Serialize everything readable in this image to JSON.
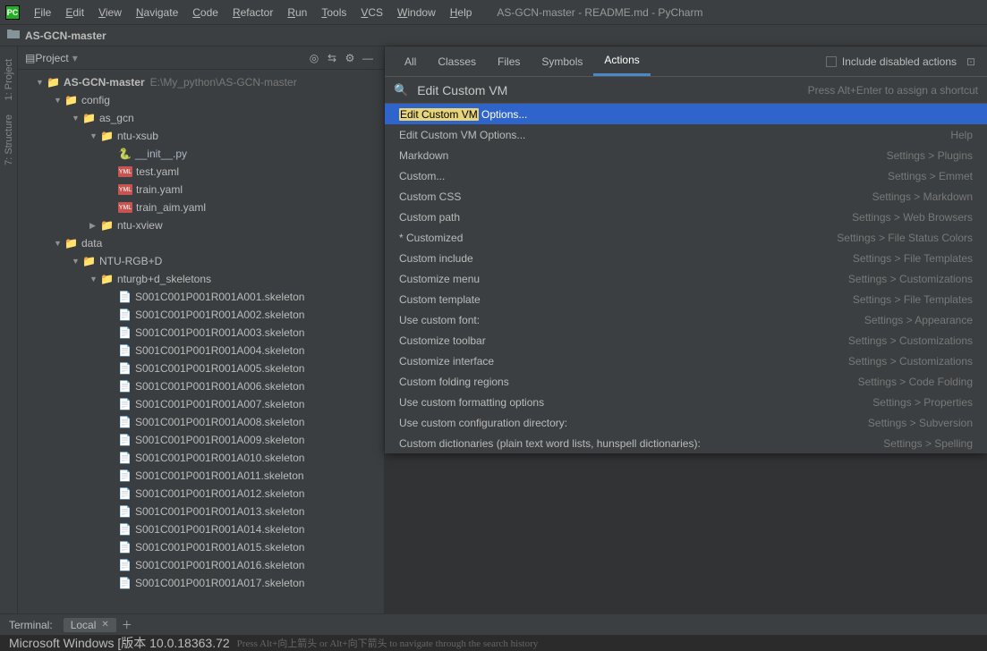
{
  "window": {
    "title": "AS-GCN-master - README.md - PyCharm"
  },
  "menu": {
    "items": [
      "File",
      "Edit",
      "View",
      "Navigate",
      "Code",
      "Refactor",
      "Run",
      "Tools",
      "VCS",
      "Window",
      "Help"
    ]
  },
  "breadcrumb": {
    "root": "AS-GCN-master"
  },
  "gutter": {
    "tab1": "1: Project",
    "tab2": "7: Structure"
  },
  "project": {
    "title": "Project",
    "root": {
      "name": "AS-GCN-master",
      "path": "E:\\My_python\\AS-GCN-master"
    },
    "tree": {
      "config": "config",
      "as_gcn": "as_gcn",
      "ntu_xsub": "ntu-xsub",
      "init_py": "__init__.py",
      "test_yaml": "test.yaml",
      "train_yaml": "train.yaml",
      "train_aim_yaml": "train_aim.yaml",
      "ntu_xview": "ntu-xview",
      "data": "data",
      "ntu_rgbd": "NTU-RGB+D",
      "skel_folder": "nturgb+d_skeletons"
    },
    "skeletons": [
      "S001C001P001R001A001.skeleton",
      "S001C001P001R001A002.skeleton",
      "S001C001P001R001A003.skeleton",
      "S001C001P001R001A004.skeleton",
      "S001C001P001R001A005.skeleton",
      "S001C001P001R001A006.skeleton",
      "S001C001P001R001A007.skeleton",
      "S001C001P001R001A008.skeleton",
      "S001C001P001R001A009.skeleton",
      "S001C001P001R001A010.skeleton",
      "S001C001P001R001A011.skeleton",
      "S001C001P001R001A012.skeleton",
      "S001C001P001R001A013.skeleton",
      "S001C001P001R001A014.skeleton",
      "S001C001P001R001A015.skeleton",
      "S001C001P001R001A016.skeleton",
      "S001C001P001R001A017.skeleton"
    ]
  },
  "popup": {
    "tabs": [
      "All",
      "Classes",
      "Files",
      "Symbols",
      "Actions"
    ],
    "active_tab": 4,
    "include_label": "Include disabled actions",
    "include_checked": false,
    "search_value": "Edit Custom VM",
    "search_hint": "Press Alt+Enter to assign a shortcut",
    "results": [
      {
        "label_hl": "Edit Custom VM",
        "label_rest": " Options...",
        "right": "",
        "selected": true
      },
      {
        "label_hl": "",
        "label_rest": "Edit Custom VM Options...",
        "right": "Help"
      },
      {
        "label_hl": "",
        "label_rest": "Markdown",
        "right": "Settings > Plugins"
      },
      {
        "label_hl": "",
        "label_rest": "Custom...",
        "right": "Settings > Emmet"
      },
      {
        "label_hl": "",
        "label_rest": "Custom CSS",
        "right": "Settings > Markdown"
      },
      {
        "label_hl": "",
        "label_rest": "Custom path",
        "right": "Settings > Web Browsers"
      },
      {
        "label_hl": "",
        "label_rest": "* Customized",
        "right": "Settings > File Status Colors"
      },
      {
        "label_hl": "",
        "label_rest": "Custom include",
        "right": "Settings > File Templates"
      },
      {
        "label_hl": "",
        "label_rest": "Customize menu",
        "right": "Settings > Customizations"
      },
      {
        "label_hl": "",
        "label_rest": "Custom template",
        "right": "Settings > File Templates"
      },
      {
        "label_hl": "",
        "label_rest": "Use custom font:",
        "right": "Settings > Appearance"
      },
      {
        "label_hl": "",
        "label_rest": "Customize toolbar",
        "right": "Settings > Customizations"
      },
      {
        "label_hl": "",
        "label_rest": "Customize interface",
        "right": "Settings > Customizations"
      },
      {
        "label_hl": "",
        "label_rest": "Custom folding regions",
        "right": "Settings > Code Folding"
      },
      {
        "label_hl": "",
        "label_rest": "Use custom formatting options",
        "right": "Settings > Properties"
      },
      {
        "label_hl": "",
        "label_rest": "Use custom configuration directory:",
        "right": "Settings > Subversion"
      },
      {
        "label_hl": "",
        "label_rest": "Custom dictionaries (plain text word lists, hunspell dictionaries):",
        "right": "Settings > Spelling"
      }
    ]
  },
  "terminal": {
    "tab_label": "Terminal:",
    "tab_name": "Local",
    "content": "Microsoft Windows [版本 10.0.18363.72",
    "status_hint": "Press Alt+向上箭头 or Alt+向下箭头 to navigate through the search history"
  }
}
